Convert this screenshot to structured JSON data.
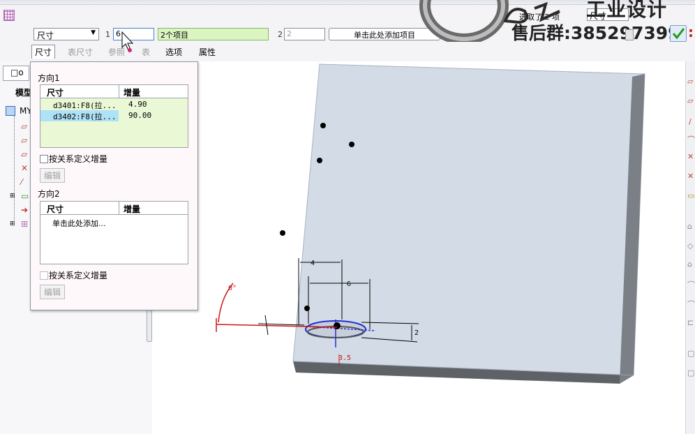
{
  "toolbar": {
    "type_select": "尺寸",
    "field1_label": "1",
    "field1_value": "6",
    "items_field": "2个项目",
    "field2_label": "2",
    "field2_value": "2",
    "add_item_button": "单击此处添加项目",
    "selected_count": "选取了 2 项",
    "filter_value": "尺寸"
  },
  "watermark": {
    "line1": "工业设计",
    "line2": "售后群:385297399"
  },
  "tabs": [
    {
      "label": "尺寸",
      "state": "active"
    },
    {
      "label": "表尺寸",
      "state": "disabled"
    },
    {
      "label": "参照",
      "state": "disabled"
    },
    {
      "label": "表",
      "state": "disabled"
    },
    {
      "label": "选项",
      "state": "normal"
    },
    {
      "label": "属性",
      "state": "normal"
    }
  ],
  "model_tree": {
    "header": "模型",
    "root": "MY"
  },
  "dimension_panel": {
    "direction1_title": "方向1",
    "direction2_title": "方向2",
    "col_dim": "尺寸",
    "col_increment": "增量",
    "dir1_rows": [
      {
        "dim": "d3401:F8(拉...",
        "increment": "4.90"
      },
      {
        "dim": "d3402:F8(拉...",
        "increment": "90.00"
      }
    ],
    "dir2_placeholder": "单击此处添加...",
    "relation_checkbox": "按关系定义增量",
    "edit_button": "编辑"
  },
  "sketch_labels": {
    "dim_4": "4",
    "dim_6": "6",
    "dim_angle": "0°",
    "dim_35": "3.5",
    "dim_2": "2"
  }
}
